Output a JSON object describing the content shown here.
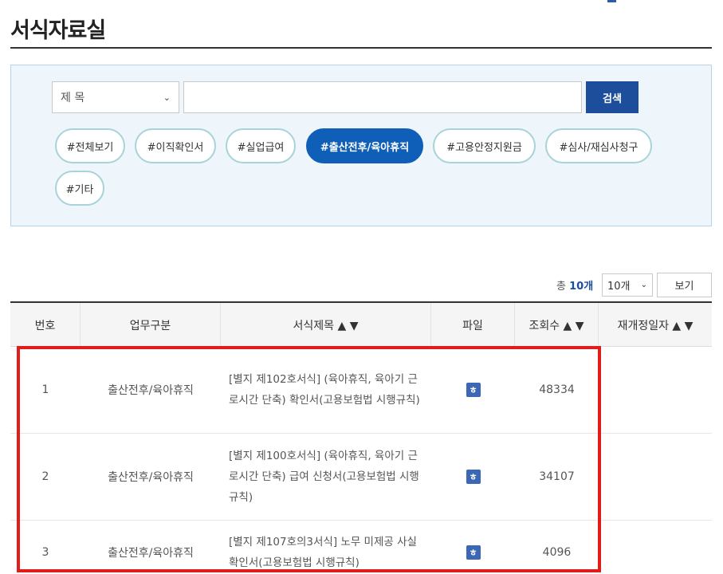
{
  "page": {
    "title": "서식자료실"
  },
  "search": {
    "field_selected": "제 목",
    "input_value": "",
    "button_label": "검색"
  },
  "tags": [
    {
      "label": "#전체보기",
      "active": false
    },
    {
      "label": "#이직확인서",
      "active": false
    },
    {
      "label": "#실업급여",
      "active": false
    },
    {
      "label": "#출산전후/육아휴직",
      "active": true
    },
    {
      "label": "#고용안정지원금",
      "active": false
    },
    {
      "label": "#심사/재심사청구",
      "active": false
    },
    {
      "label": "#기타",
      "active": false
    }
  ],
  "listing": {
    "total_prefix": "총",
    "total_count": "10개",
    "per_page": "10개",
    "view_label": "보기"
  },
  "table": {
    "headers": [
      "번호",
      "업무구분",
      "서식제목 ▲ ▼",
      "파일",
      "조회수 ▲ ▼",
      "재개정일자 ▲ ▼"
    ],
    "rows": [
      {
        "no": "1",
        "category": "출산전후/육아휴직",
        "title": "[별지 제102호서식] (육아휴직, 육아기 근로시간 단축) 확인서(고용보험법 시행규칙)",
        "file": "hwp-file-icon",
        "views": "48334",
        "date": ""
      },
      {
        "no": "2",
        "category": "출산전후/육아휴직",
        "title": "[별지 제100호서식] (육아휴직, 육아기 근로시간 단축) 급여 신청서(고용보험법 시행규칙)",
        "file": "hwp-file-icon",
        "views": "34107",
        "date": ""
      },
      {
        "no": "3",
        "category": "출산전후/육아휴직",
        "title": "[별지 제107호의3서식] 노무 미제공 사실 확인서(고용보험법 시행규칙)",
        "file": "hwp-file-icon",
        "views": "4096",
        "date": ""
      }
    ]
  },
  "file_icon_glyph": "ㅎ",
  "colors": {
    "accent": "#0f5fb8",
    "search_button": "#1c4e9c",
    "highlight": "#e41b1b",
    "tag_border": "#a8d3d8"
  }
}
